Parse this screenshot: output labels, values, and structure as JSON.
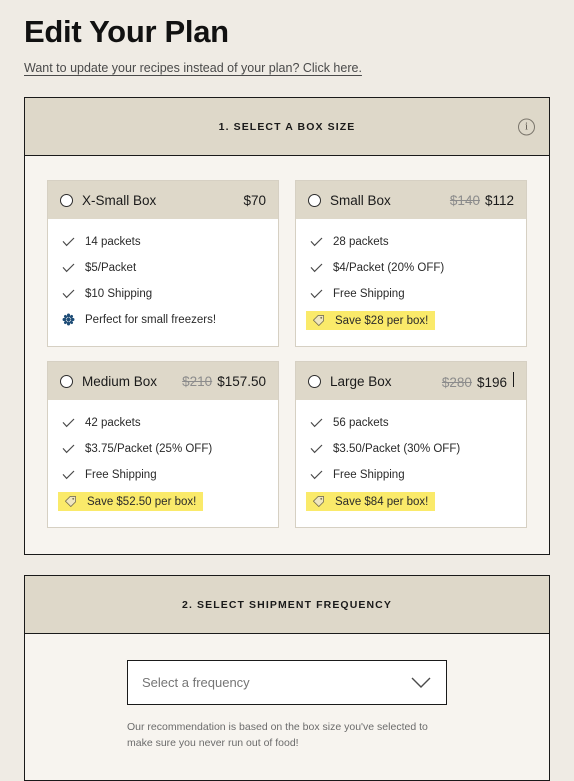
{
  "header": {
    "title": "Edit Your Plan",
    "subtitle_link": "Want to update your recipes instead of your plan? Click here."
  },
  "box_section": {
    "step_title": "1. SELECT A BOX SIZE",
    "info_icon_glyph": "i",
    "info_icon_name": "info-icon",
    "boxes": [
      {
        "name": "X-Small Box",
        "old_price": "",
        "price": "$70",
        "selected": false,
        "has_caret": false,
        "features": [
          {
            "icon": "check-icon",
            "text": "14 packets",
            "highlight": false
          },
          {
            "icon": "check-icon",
            "text": "$5/Packet",
            "highlight": false
          },
          {
            "icon": "check-icon",
            "text": "$10 Shipping",
            "highlight": false
          },
          {
            "icon": "snowflake-icon",
            "text": "Perfect for small freezers!",
            "highlight": false
          }
        ]
      },
      {
        "name": "Small Box",
        "old_price": "$140",
        "price": "$112",
        "selected": false,
        "has_caret": false,
        "features": [
          {
            "icon": "check-icon",
            "text": "28 packets",
            "highlight": false
          },
          {
            "icon": "check-icon",
            "text": "$4/Packet (20% OFF)",
            "highlight": false
          },
          {
            "icon": "check-icon",
            "text": "Free Shipping",
            "highlight": false
          },
          {
            "icon": "price-tag-icon",
            "text": "Save $28 per box!",
            "highlight": true
          }
        ]
      },
      {
        "name": "Medium Box",
        "old_price": "$210",
        "price": "$157.50",
        "selected": false,
        "has_caret": false,
        "features": [
          {
            "icon": "check-icon",
            "text": "42 packets",
            "highlight": false
          },
          {
            "icon": "check-icon",
            "text": "$3.75/Packet (25% OFF)",
            "highlight": false
          },
          {
            "icon": "check-icon",
            "text": "Free Shipping",
            "highlight": false
          },
          {
            "icon": "price-tag-icon",
            "text": "Save $52.50 per box!",
            "highlight": true
          }
        ]
      },
      {
        "name": "Large Box",
        "old_price": "$280",
        "price": "$196",
        "selected": false,
        "has_caret": true,
        "features": [
          {
            "icon": "check-icon",
            "text": "56 packets",
            "highlight": false
          },
          {
            "icon": "check-icon",
            "text": "$3.50/Packet (30% OFF)",
            "highlight": false
          },
          {
            "icon": "check-icon",
            "text": "Free Shipping",
            "highlight": false
          },
          {
            "icon": "price-tag-icon",
            "text": "Save $84 per box!",
            "highlight": true
          }
        ]
      }
    ]
  },
  "frequency_section": {
    "step_title": "2. SELECT SHIPMENT FREQUENCY",
    "select_placeholder": "Select a frequency",
    "chevron_icon": "chevron-down-icon",
    "note": "Our recommendation is based on the box size you've selected to make sure you never run out of food!"
  },
  "colors": {
    "page_background": "#efebe4",
    "panel_background": "#f7f4ef",
    "header_strip": "#ded8c9",
    "border": "#1a1a1a",
    "highlight_yellow": "#faea6a",
    "muted_text": "#6b6b6b"
  }
}
